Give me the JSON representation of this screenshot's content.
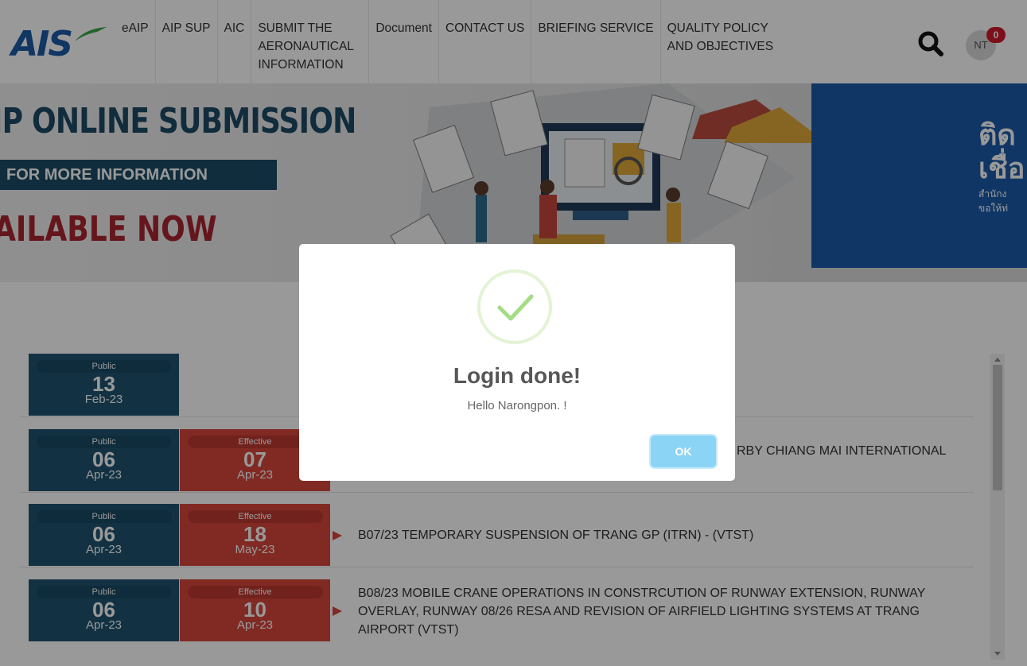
{
  "header": {
    "logo_text": "AIS",
    "nav": [
      {
        "label": "eAIP"
      },
      {
        "label": "AIP SUP"
      },
      {
        "label": "AIC"
      },
      {
        "label": "SUBMIT THE AERONAUTICAL INFORMATION"
      },
      {
        "label": "Document"
      },
      {
        "label": "CONTACT US"
      },
      {
        "label": "BRIEFING SERVICE"
      },
      {
        "label": "QUALITY POLICY AND OBJECTIVES"
      }
    ],
    "search_icon": "search-icon",
    "user_initials": "NT",
    "notification_count": "0"
  },
  "banner": {
    "title": "IP ONLINE SUBMISSION",
    "info": "FOR MORE INFORMATION",
    "available": "AILABLE NOW",
    "thai_title_1": "ติด",
    "thai_title_2": "เชื่อ",
    "thai_sub_1": "สำนักง",
    "thai_sub_2": "ขอให้ท่"
  },
  "list": {
    "rows": [
      {
        "public_tag": "Public",
        "public_day": "13",
        "public_month": "Feb-23",
        "effective_tag": "",
        "effective_day": "",
        "effective_month": "",
        "title": ""
      },
      {
        "public_tag": "Public",
        "public_day": "06",
        "public_month": "Apr-23",
        "effective_tag": "Effective",
        "effective_day": "07",
        "effective_month": "Apr-23",
        "title": "RBY CHIANG MAI INTERNATIONAL"
      },
      {
        "public_tag": "Public",
        "public_day": "06",
        "public_month": "Apr-23",
        "effective_tag": "Effective",
        "effective_day": "18",
        "effective_month": "May-23",
        "title": "B07/23 TEMPORARY SUSPENSION OF TRANG GP (ITRN) - (VTST)"
      },
      {
        "public_tag": "Public",
        "public_day": "06",
        "public_month": "Apr-23",
        "effective_tag": "Effective",
        "effective_day": "10",
        "effective_month": "Apr-23",
        "title": "B08/23 MOBILE CRANE OPERATIONS IN CONSTRCUTION OF RUNWAY EXTENSION, RUNWAY OVERLAY, RUNWAY 08/26 RESA AND REVISION OF AIRFIELD LIGHTING SYSTEMS AT TRANG AIRPORT (VTST)"
      }
    ]
  },
  "modal": {
    "icon": "success-check-icon",
    "title": "Login done!",
    "text": "Hello Narongpon. !",
    "ok_label": "OK",
    "accent_color": "#8cd4f5",
    "check_color": "#a5dc86"
  }
}
